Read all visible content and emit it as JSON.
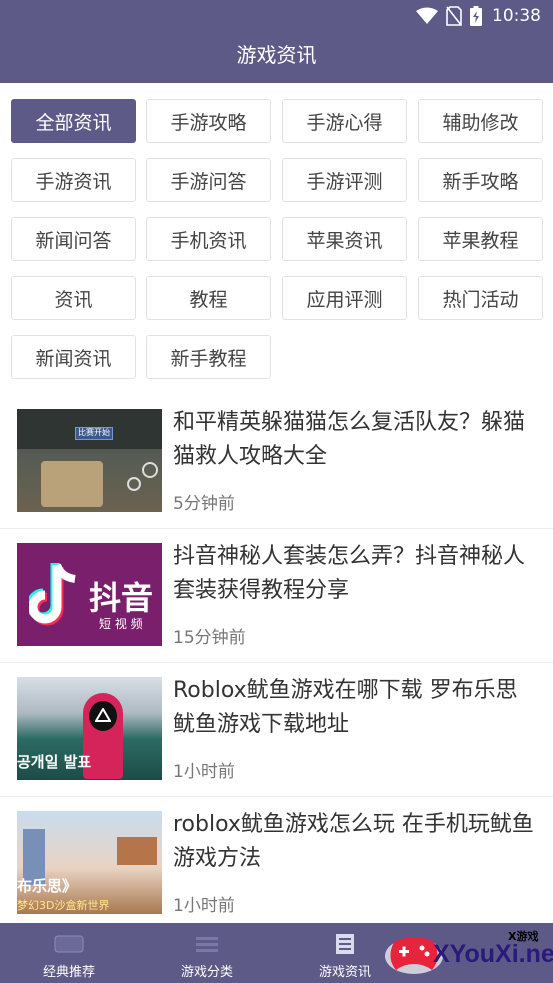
{
  "status_bar": {
    "time": "10:38"
  },
  "page": {
    "title": "游戏资讯"
  },
  "categories": [
    {
      "label": "全部资讯",
      "active": true
    },
    {
      "label": "手游攻略"
    },
    {
      "label": "手游心得"
    },
    {
      "label": "辅助修改"
    },
    {
      "label": "手游资讯"
    },
    {
      "label": "手游问答"
    },
    {
      "label": "手游评测"
    },
    {
      "label": "新手攻略"
    },
    {
      "label": "新闻问答"
    },
    {
      "label": "手机资讯"
    },
    {
      "label": "苹果资讯"
    },
    {
      "label": "苹果教程"
    },
    {
      "label": "资讯"
    },
    {
      "label": "教程"
    },
    {
      "label": "应用评测"
    },
    {
      "label": "热门活动"
    },
    {
      "label": "新闻资讯"
    },
    {
      "label": "新手教程"
    }
  ],
  "articles": [
    {
      "title": "和平精英躲猫猫怎么复活队友？躲猫猫救人攻略大全",
      "time": "5分钟前",
      "thumb": {
        "caption": "比赛开始"
      }
    },
    {
      "title": "抖音神秘人套装怎么弄？抖音神秘人套装获得教程分享",
      "time": "15分钟前",
      "thumb": {
        "brand": "抖音",
        "sub": "短 视 频"
      }
    },
    {
      "title": "Roblox鱿鱼游戏在哪下载 罗布乐思鱿鱼游戏下载地址",
      "time": "1小时前",
      "thumb": {
        "caption": "공개일 발표"
      }
    },
    {
      "title": "roblox鱿鱼游戏怎么玩 在手机玩鱿鱼游戏方法",
      "time": "1小时前",
      "thumb": {
        "caption": "布乐思》",
        "sub": "梦幻3D沙盒新世界"
      }
    }
  ],
  "bottom_nav": [
    {
      "label": "经典推荐",
      "icon": "classic-icon"
    },
    {
      "label": "游戏分类",
      "icon": "category-icon"
    },
    {
      "label": "游戏资讯",
      "icon": "news-icon"
    },
    {
      "label": "",
      "icon": "profile-icon"
    }
  ],
  "watermark": {
    "text": "XYouXi.net",
    "sub": "X游戏"
  },
  "colors": {
    "primary": "#5d5a87",
    "watermark_red": "#e8233c"
  }
}
